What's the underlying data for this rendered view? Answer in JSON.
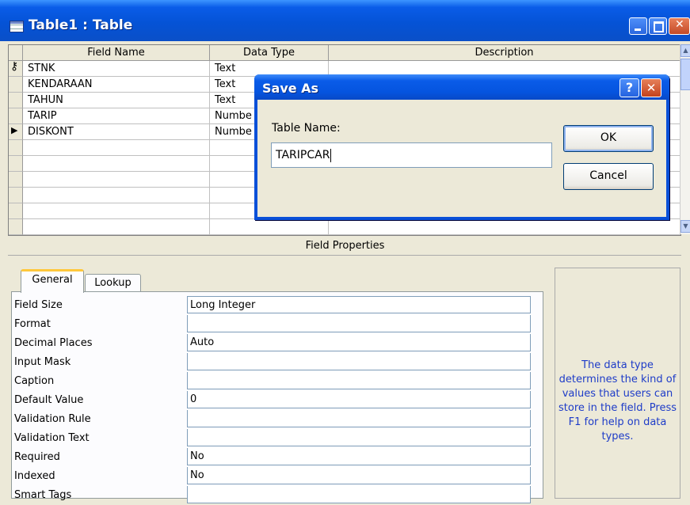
{
  "window": {
    "title": "Table1 : Table"
  },
  "grid": {
    "headers": [
      "Field Name",
      "Data Type",
      "Description"
    ],
    "rows": [
      {
        "name": "STNK",
        "type": "Text",
        "key": true,
        "current": false
      },
      {
        "name": "KENDARAAN",
        "type": "Text",
        "key": false,
        "current": false
      },
      {
        "name": "TAHUN",
        "type": "Text",
        "key": false,
        "current": false
      },
      {
        "name": "TARIP",
        "type": "Numbe",
        "key": false,
        "current": false
      },
      {
        "name": "DISKONT",
        "type": "Numbe",
        "key": false,
        "current": true
      }
    ]
  },
  "field_properties": {
    "title": "Field Properties",
    "tabs": [
      "General",
      "Lookup"
    ],
    "active_tab": "General",
    "rows": [
      {
        "label": "Field Size",
        "value": "Long Integer"
      },
      {
        "label": "Format",
        "value": ""
      },
      {
        "label": "Decimal Places",
        "value": "Auto"
      },
      {
        "label": "Input Mask",
        "value": ""
      },
      {
        "label": "Caption",
        "value": ""
      },
      {
        "label": "Default Value",
        "value": "0"
      },
      {
        "label": "Validation Rule",
        "value": ""
      },
      {
        "label": "Validation Text",
        "value": ""
      },
      {
        "label": "Required",
        "value": "No"
      },
      {
        "label": "Indexed",
        "value": "No"
      },
      {
        "label": "Smart Tags",
        "value": ""
      }
    ],
    "help_text": "The data type determines the kind of values that users can store in the field.  Press F1 for help on data types."
  },
  "dialog": {
    "title": "Save As",
    "label": "Table Name:",
    "value": "TARIPCAR",
    "ok": "OK",
    "cancel": "Cancel",
    "help_glyph": "?",
    "close_glyph": "✕"
  },
  "colors": {
    "titlebar": "#0a5ce8",
    "help_text": "#1e3cc8",
    "tab_highlight": "#ffc83c"
  }
}
